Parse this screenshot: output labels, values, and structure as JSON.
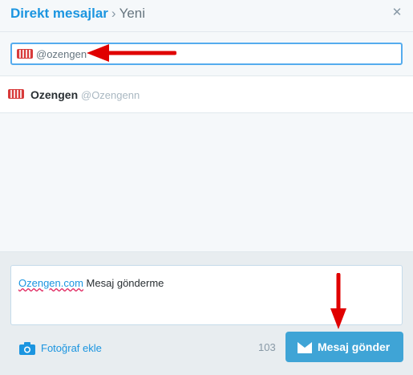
{
  "header": {
    "breadcrumb_link": "Direkt mesajlar",
    "separator": "›",
    "current": "Yeni",
    "close_glyph": "✕"
  },
  "recipient": {
    "value": "@ozengen",
    "avatar_icon": "ozengen-avatar-icon"
  },
  "suggestion": {
    "name": "Ozengen",
    "handle": "@Ozengenn"
  },
  "composer": {
    "message_link": "Ozengen.com",
    "message_rest": " Mesaj gönderme",
    "photo_label": "Fotoğraf ekle",
    "char_count": "103",
    "send_label": "Mesaj gönder"
  },
  "colors": {
    "accent": "#1b95e0",
    "send_button": "#3fa4d6",
    "annotation_arrow": "#e00000"
  }
}
